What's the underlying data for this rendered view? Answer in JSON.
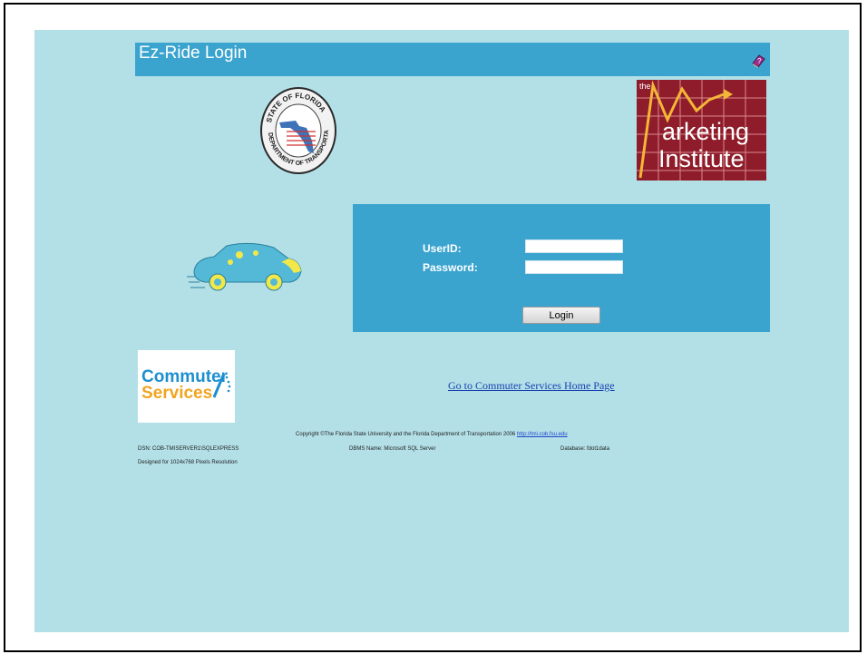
{
  "header": {
    "title": "Ez-Ride  Login",
    "help_icon": "help-book-icon"
  },
  "logos": {
    "fdot_seal": {
      "text": "STATE OF FLORIDA • DEPARTMENT OF TRANSPORTATION"
    },
    "marketing_institute": {
      "the": "the",
      "line1": "arketing",
      "line2": "Institute"
    },
    "commuter_services": {
      "line1": "Commuter",
      "line2": "Services"
    }
  },
  "login": {
    "userid_label": "UserID:",
    "password_label": "Password:",
    "userid_value": "",
    "password_value": "",
    "button_label": "Login"
  },
  "links": {
    "commuter_home": "Go to Commuter Services Home Page"
  },
  "footer": {
    "copyright": "Copyright ©The Florida State University and the Florida Department of Transportation 2006",
    "copyright_url": "http://tmi.cob.fsu.edu",
    "dsn": "DSN: COB-TMISERVER1\\SQLEXPRESS",
    "dbms": "DBMS Name: Microsoft SQL Server",
    "database": "Database: fdot1data",
    "resolution": "Designed for 1024x768 Pixels Resolution"
  },
  "colors": {
    "page_bg": "#b3e0e7",
    "bar_blue": "#3aa4cf",
    "mi_red": "#8e1c2a",
    "link_blue": "#1a3fb0"
  }
}
